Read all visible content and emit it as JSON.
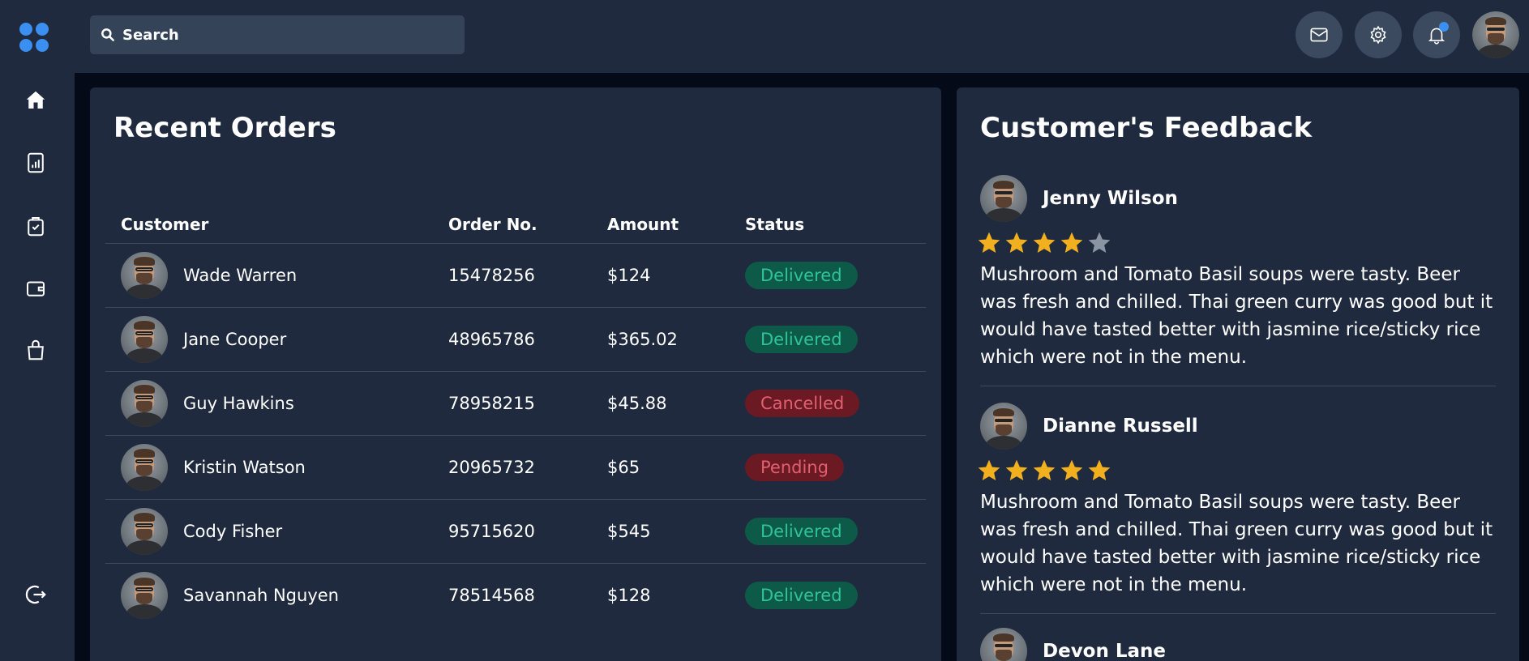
{
  "search": {
    "placeholder": "Search"
  },
  "colors": {
    "accent": "#3a8ff0",
    "delivered_bg": "#0e5a48",
    "delivered_fg": "#2ec39a",
    "cancelled_bg": "#6b1a24",
    "cancelled_fg": "#e06070",
    "pending_bg": "#6b1a24",
    "pending_fg": "#e06070",
    "star_on": "#f2b01e",
    "star_off": "#8a94a3"
  },
  "sidebar": {
    "icons": [
      "home-icon",
      "report-icon",
      "tasks-icon",
      "wallet-icon",
      "shopping-bag-icon",
      "logout-icon"
    ]
  },
  "orders": {
    "title": "Recent Orders",
    "columns": [
      "Customer",
      "Order No.",
      "Amount",
      "Status"
    ],
    "rows": [
      {
        "customer": "Wade Warren",
        "order_no": "15478256",
        "amount": "$124",
        "status": "Delivered",
        "status_type": "delivered"
      },
      {
        "customer": "Jane Cooper",
        "order_no": "48965786",
        "amount": "$365.02",
        "status": "Delivered",
        "status_type": "delivered"
      },
      {
        "customer": "Guy Hawkins",
        "order_no": "78958215",
        "amount": "$45.88",
        "status": "Cancelled",
        "status_type": "cancelled"
      },
      {
        "customer": "Kristin Watson",
        "order_no": "20965732",
        "amount": "$65",
        "status": "Pending",
        "status_type": "pending"
      },
      {
        "customer": "Cody Fisher",
        "order_no": "95715620",
        "amount": "$545",
        "status": "Delivered",
        "status_type": "delivered"
      },
      {
        "customer": "Savannah Nguyen",
        "order_no": "78514568",
        "amount": "$128",
        "status": "Delivered",
        "status_type": "delivered"
      }
    ]
  },
  "feedback": {
    "title": "Customer's Feedback",
    "items": [
      {
        "name": "Jenny Wilson",
        "rating": 4,
        "text": "Mushroom and Tomato Basil soups were tasty. Beer was fresh and chilled. Thai green curry was good but it would have tasted better with jasmine rice/sticky rice which were not in the menu."
      },
      {
        "name": "Dianne Russell",
        "rating": 5,
        "text": "Mushroom and Tomato Basil soups were tasty. Beer was fresh and chilled. Thai green curry was good but it would have tasted better with jasmine rice/sticky rice which were not in the menu."
      },
      {
        "name": "Devon Lane",
        "rating": 0,
        "text": ""
      }
    ]
  }
}
